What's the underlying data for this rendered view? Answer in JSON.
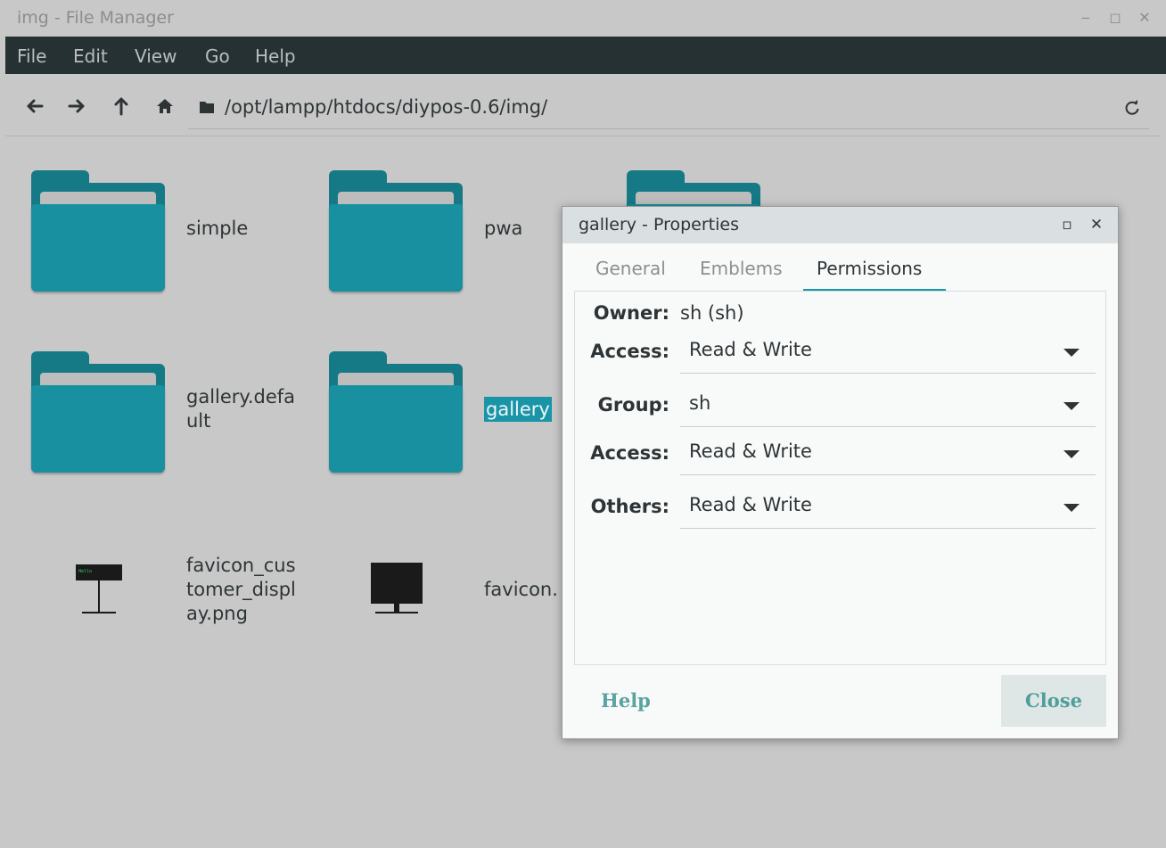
{
  "window": {
    "title": "img - File Manager"
  },
  "menu": [
    "File",
    "Edit",
    "View",
    "Go",
    "Help"
  ],
  "location": {
    "path": "/opt/lampp/htdocs/diypos-0.6/img/"
  },
  "files": [
    {
      "label": "simple"
    },
    {
      "label": "pwa"
    },
    {
      "label": "gallery.defa\nult"
    },
    {
      "label": "gallery"
    },
    {
      "label": "favicon_cus\ntomer_displ\nay.png"
    },
    {
      "label": "favicon."
    }
  ],
  "dialog": {
    "title": "gallery - Properties",
    "tabs": [
      "General",
      "Emblems",
      "Permissions"
    ],
    "active_tab": "Permissions",
    "owner": {
      "label": "Owner:",
      "value": "sh (sh)"
    },
    "owner_access": {
      "label": "Access:",
      "value": "Read & Write"
    },
    "group": {
      "label": "Group:",
      "value": "sh"
    },
    "group_access": {
      "label": "Access:",
      "value": "Read & Write"
    },
    "others": {
      "label": "Others:",
      "value": "Read & Write"
    },
    "help_label": "Help",
    "close_label": "Close"
  },
  "colors": {
    "accent": "#1a95a8",
    "menubar": "#263133",
    "folder": "#1890a0"
  }
}
